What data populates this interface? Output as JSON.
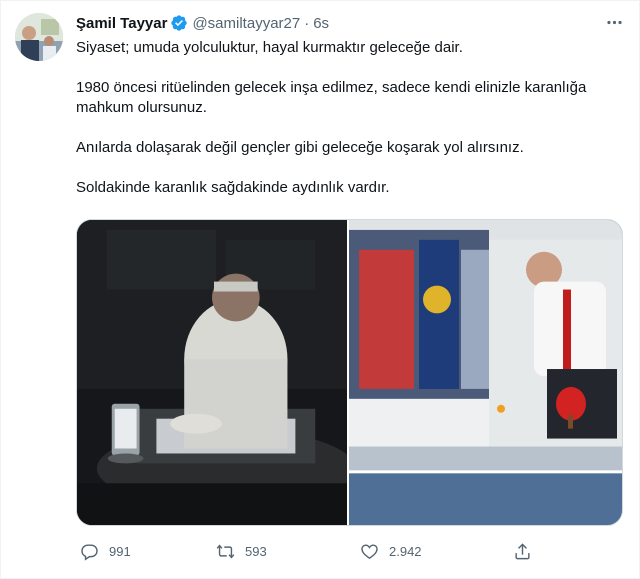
{
  "tweet": {
    "display_name": "Şamil Tayyar",
    "handle": "@samiltayyar27",
    "separator": "·",
    "time": "6s",
    "paragraphs": [
      "Siyaset; umuda yolculuktur, hayal kurmaktır geleceğe dair.",
      "1980 öncesi ritüelinden gelecek inşa edilmez, sadece kendi elinizle karanlığa mahkum olursunuz.",
      "Anılarda dolaşarak değil gençler gibi geleceğe koşarak yol alırsınız.",
      "Soldakinde karanlık sağdakinde aydınlık vardır."
    ]
  },
  "actions": {
    "reply_count": "991",
    "retweet_count": "593",
    "like_count": "2.942"
  },
  "icons": {
    "verified": "verified-badge-icon",
    "more": "more-horizontal-icon",
    "reply": "reply-icon",
    "retweet": "retweet-icon",
    "like": "heart-icon",
    "share": "share-icon"
  },
  "colors": {
    "text": "#0f1419",
    "secondary": "#536471",
    "verified": "#1d9bf0",
    "border": "#cfd9de"
  }
}
